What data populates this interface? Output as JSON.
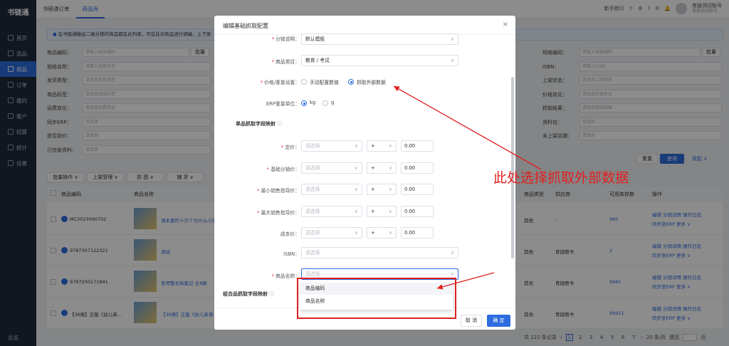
{
  "app": {
    "logo": "书链通",
    "sidebar": [
      "首页",
      "选品",
      "商品",
      "订单",
      "履约",
      "客户",
      "结算",
      "统计",
      "设置"
    ],
    "sidebar_active": 2,
    "sidebar_bottom": "总览",
    "tabs": [
      "书链通订单",
      "商品库"
    ],
    "active_tab": 1,
    "top_right": {
      "guide": "新手指引",
      "account_name": "育链测试账号",
      "account_sub": "育链测试账号"
    }
  },
  "background": {
    "notice": "在书链通输出二级分销的商品都在此列表，可在此对商品进行调编，上下架",
    "filters_left": [
      {
        "label": "商品编码：",
        "placeholder": "请输入商品编码",
        "btn": "批量"
      },
      {
        "label": "规格名称：",
        "placeholder": "请输入规格名称"
      },
      {
        "label": "发货类型：",
        "placeholder": "请选择发货类型"
      },
      {
        "label": "商品标签：",
        "placeholder": "请选择商品标签"
      },
      {
        "label": "运费变化：",
        "placeholder": "请选择运费变化"
      },
      {
        "label": "同步ERP：",
        "placeholder": "请选择"
      },
      {
        "label": "是否锁价：",
        "placeholder": "请选择"
      },
      {
        "label": "已完善资料：",
        "placeholder": "请选择"
      }
    ],
    "filters_right": [
      {
        "label": "规格编码：",
        "placeholder": "请输入规格编码",
        "btn": "批量"
      },
      {
        "label": "ISBN：",
        "placeholder": "请输入ISBN"
      },
      {
        "label": "上架状态：",
        "placeholder": "请选择上架状态"
      },
      {
        "label": "价格变化：",
        "placeholder": "请选择价格变化"
      },
      {
        "label": "抓取结果：",
        "placeholder": "请选择抓取结果"
      },
      {
        "label": "资料包：",
        "placeholder": "请选择"
      },
      {
        "label": "未上架店铺：",
        "placeholder": "请选择"
      }
    ],
    "filter_buttons": {
      "reset": "重置",
      "search": "查询",
      "collapse": "收起 ∧"
    },
    "toolbar": [
      "批量操作 ∨",
      "上架管理 ∨",
      "抓 图 ∨",
      "铺 货 ∨"
    ],
    "columns": {
      "code": "商品编码",
      "name": "商品名称",
      "type": "商品类型",
      "supplier": "供应商",
      "stock": "可用库存数",
      "ops": "操作"
    },
    "rows": [
      {
        "code": "MC2023090702",
        "name": "课本里的十万个为什么小学...",
        "type": "其他",
        "supplier": "-",
        "stock": "960",
        "ops1": "编辑  分销详情  操作日志",
        "ops2": "同步至ERP  更多 ∨"
      },
      {
        "code": "9787307122321",
        "name": "测试",
        "type": "其他",
        "supplier": "育链图书",
        "stock": "2",
        "ops1": "编辑  分销详情  操作日志",
        "ops2": "同步至ERP  更多 ∨"
      },
      {
        "code": "9787200171891",
        "name": "老师整长探案记 全8册",
        "type": "其他",
        "supplier": "育链图书",
        "stock": "9981",
        "ops1": "编辑  分销详情  操作日志",
        "ops2": "同步至ERP  更多 ∨"
      },
      {
        "code": "【36册】正版《幼儿英...",
        "name": "【36册】正版《幼儿英语...",
        "type": "其他",
        "supplier": "育链图书",
        "stock": "99911",
        "ops1": "编辑  分销详情  操作日志",
        "ops2": "同步至ERP  更多 ∨"
      }
    ],
    "pager": {
      "total": "共 122 条记录",
      "pages": [
        "1",
        "2",
        "3",
        "4",
        "5",
        "6",
        "7"
      ],
      "active": "1",
      "size": "20 条/页",
      "jump": "跳至",
      "unit": "页"
    }
  },
  "modal": {
    "title": "编辑基础抓取配置",
    "close": "×",
    "fields": {
      "desc_label": "分销说明：",
      "desc_value": "默认模板",
      "category_label": "商品类目：",
      "category_value": "教育 / 考试",
      "price_weight_label": "价格/重量设置：",
      "price_opt_manual": "手动配置数值",
      "price_opt_fetch": "抓取外部数据",
      "erp_unit_label": "ERP重量单位：",
      "unit_kg": "kg",
      "unit_g": "g"
    },
    "single_section": "单品抓取字段映射",
    "mapping_rows": [
      {
        "label": "定价：",
        "required": true,
        "select": "请选择",
        "op": "+",
        "num": "0.00"
      },
      {
        "label": "基础分销价：",
        "required": true,
        "select": "请选择",
        "op": "+",
        "num": "0.00"
      },
      {
        "label": "最小销售指导价：",
        "required": true,
        "select": "请选择",
        "op": "+",
        "num": "0.00"
      },
      {
        "label": "最大销售指导价：",
        "required": true,
        "select": "请选择",
        "op": "+",
        "num": "0.00"
      },
      {
        "label": "成本价：",
        "required": false,
        "select": "请选择",
        "op": "+",
        "num": "0.00"
      }
    ],
    "isbn_label": "ISBN：",
    "isbn_placeholder": "请选择",
    "name_label": "商品名称：",
    "name_placeholder": "请选择",
    "combo_section": "组合品抓取字段映射",
    "dropdown_options": [
      "商品编码",
      "商品名称"
    ],
    "cancel": "取 消",
    "confirm": "确 定"
  },
  "annotation": {
    "text": "此处选择抓取外部数据",
    "color": "#e02020"
  },
  "colors": {
    "primary": "#2d6cdf",
    "sidebar": "#1f2a3c",
    "annotation_red": "#e02020"
  }
}
